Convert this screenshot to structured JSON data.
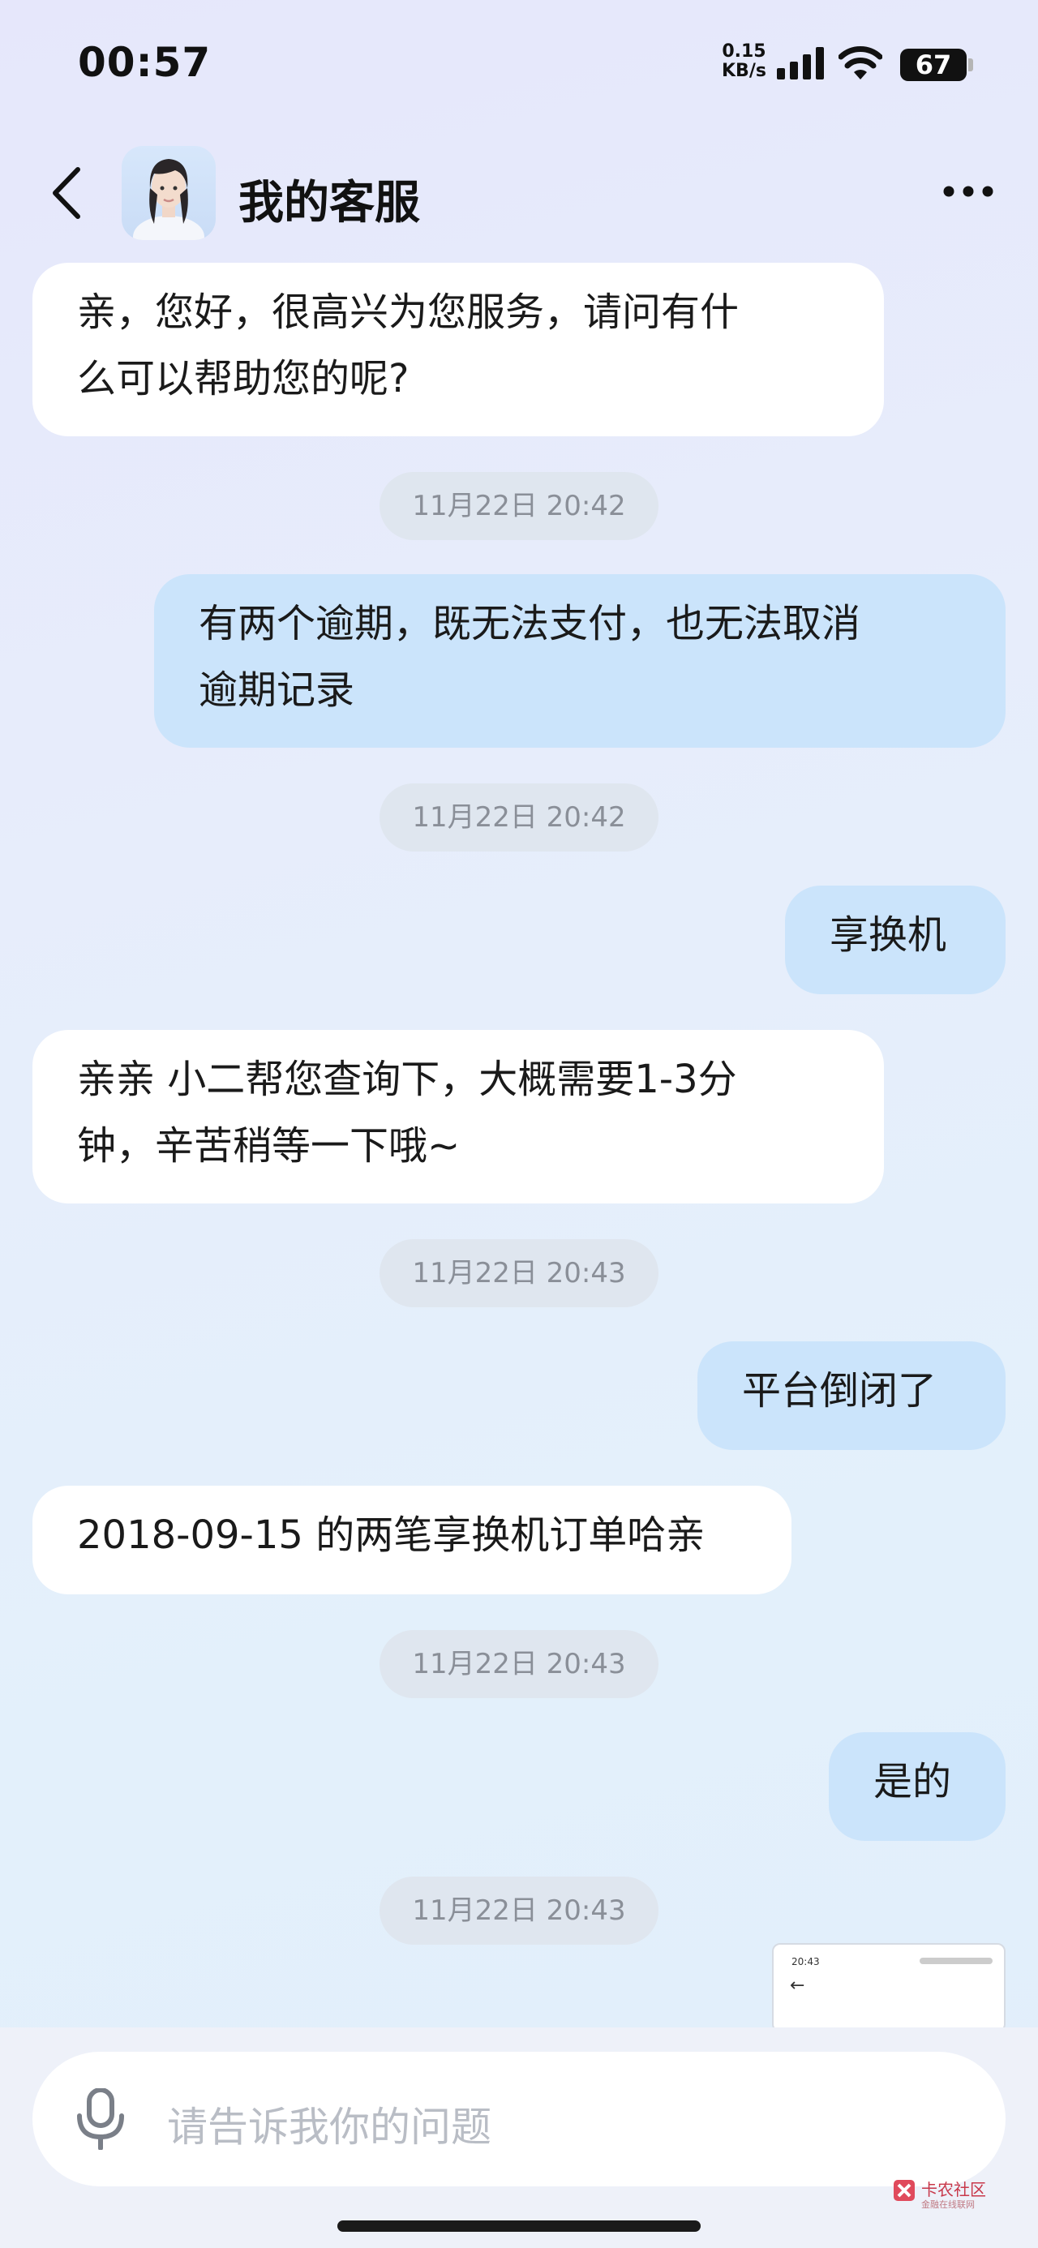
{
  "status_bar": {
    "time": "00:57",
    "net_speed_value": "0.15",
    "net_speed_unit": "KB/s",
    "battery": "67"
  },
  "header": {
    "title": "我的客服"
  },
  "messages": [
    {
      "side": "left",
      "text_lines": [
        "亲，您好，很高兴为您服务，请问有什",
        "么可以帮助您的呢?"
      ]
    },
    {
      "timestamp": "11月22日 20:42"
    },
    {
      "side": "right",
      "text_lines": [
        "有两个逾期，既无法支付，也无法取消",
        "逾期记录"
      ]
    },
    {
      "timestamp": "11月22日 20:42"
    },
    {
      "side": "right",
      "text_lines": [
        "享换机"
      ]
    },
    {
      "side": "left",
      "text_lines": [
        "亲亲 小二帮您查询下，大概需要1-3分",
        "钟，辛苦稍等一下哦~"
      ]
    },
    {
      "timestamp": "11月22日 20:43"
    },
    {
      "side": "right",
      "text_lines": [
        "平台倒闭了"
      ]
    },
    {
      "side": "left",
      "text_lines": [
        "2018-09-15 的两笔享换机订单哈亲"
      ]
    },
    {
      "timestamp": "11月22日 20:43"
    },
    {
      "side": "right",
      "text_lines": [
        "是的"
      ]
    },
    {
      "timestamp": "11月22日 20:43"
    }
  ],
  "image_message": {
    "time": "20:43",
    "back_glyph": "←"
  },
  "input": {
    "placeholder": "请告诉我你的问题"
  },
  "watermark": {
    "title": "卡农社区",
    "subtitle": "金融在线联网"
  },
  "colors": {
    "bubble_left": "#ffffff",
    "bubble_right": "#cbe4fb",
    "timestamp_bg": "#dfe6ef"
  }
}
